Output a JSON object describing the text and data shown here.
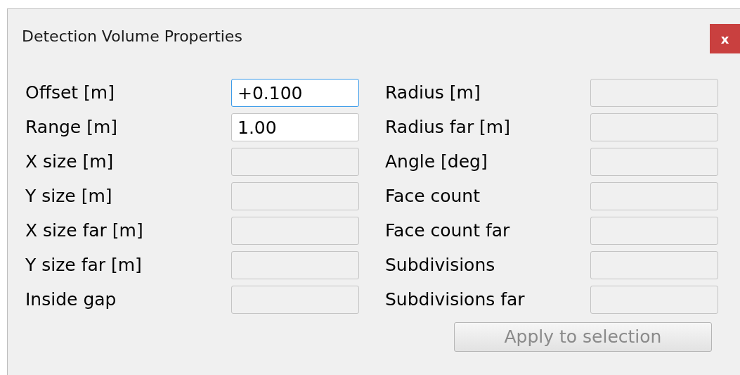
{
  "window": {
    "title": "Detection Volume Properties",
    "close": "x"
  },
  "left_fields": [
    {
      "label": "Offset [m]",
      "value": "+0.100",
      "disabled": false,
      "focused": true
    },
    {
      "label": "Range [m]",
      "value": "1.00",
      "disabled": false,
      "focused": false
    },
    {
      "label": "X size [m]",
      "disabled": true,
      "focused": false
    },
    {
      "label": "Y size [m]",
      "disabled": true,
      "focused": false
    },
    {
      "label": "X size far [m]",
      "disabled": true,
      "focused": false
    },
    {
      "label": "Y size far [m]",
      "disabled": true,
      "focused": false
    },
    {
      "label": "Inside gap",
      "disabled": true,
      "focused": false
    }
  ],
  "right_fields": [
    {
      "label": "Radius [m]",
      "disabled": true,
      "focused": false
    },
    {
      "label": "Radius far [m]",
      "disabled": true,
      "focused": false
    },
    {
      "label": "Angle [deg]",
      "disabled": true,
      "focused": false
    },
    {
      "label": "Face count",
      "disabled": true,
      "focused": false
    },
    {
      "label": "Face count far",
      "disabled": true,
      "focused": false
    },
    {
      "label": "Subdivisions",
      "disabled": true,
      "focused": false
    },
    {
      "label": "Subdivisions far",
      "disabled": true,
      "focused": false
    }
  ],
  "apply_button": {
    "label": "Apply to selection",
    "disabled": true
  }
}
